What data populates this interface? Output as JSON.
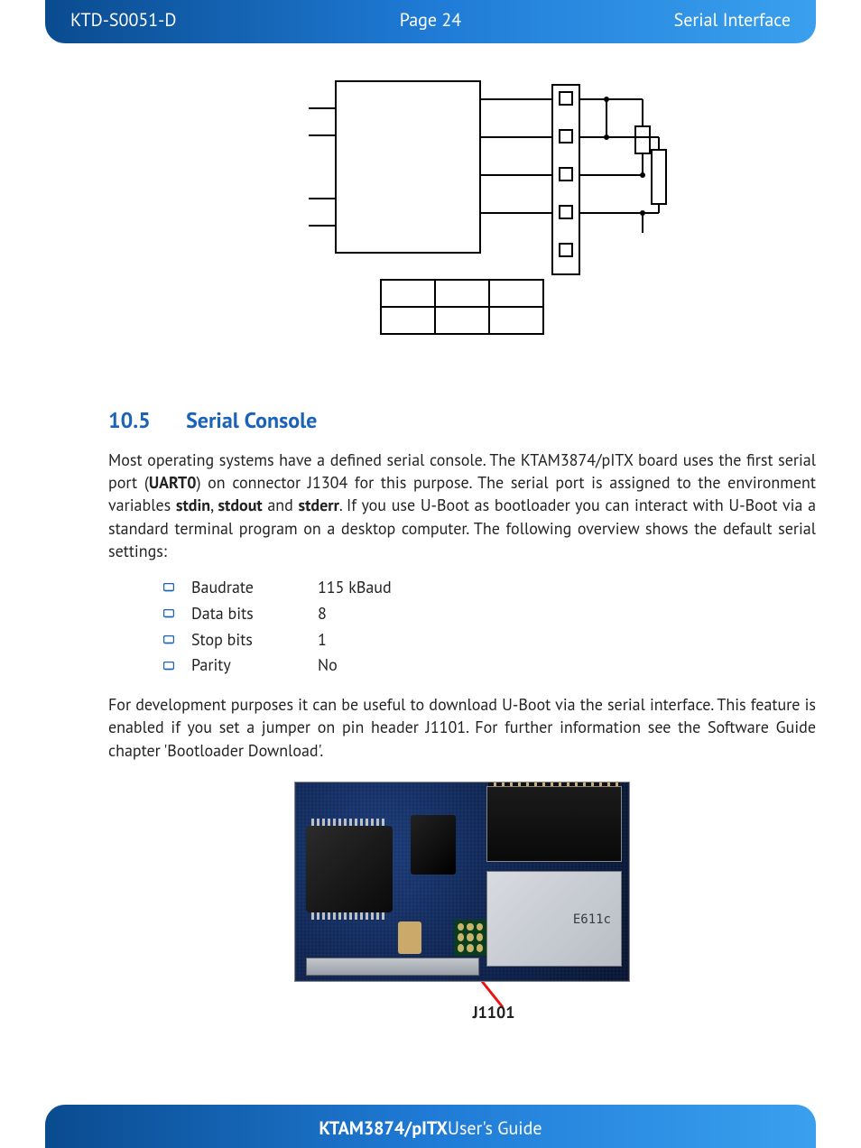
{
  "header": {
    "doc_id": "KTD-S0051-D",
    "page_label": "Page 24",
    "section": "Serial Interface"
  },
  "footer": {
    "product_bold": "KTAM3874/pITX",
    "product_rest": " User's Guide"
  },
  "section_heading": {
    "number": "10.5",
    "title": "Serial Console"
  },
  "para1": {
    "t1": "Most operating systems have a defined serial console. The KTAM3874/pITX board uses the first serial port (",
    "uart": "UART0",
    "t2": ") on connector J1304 for this purpose. The serial port is assigned to the environment variables ",
    "stdin": "stdin",
    "comma1": ", ",
    "stdout": "stdout",
    "and": " and ",
    "stderr": "stderr",
    "t3": ". If you use U-Boot as bootloader you can interact with U-Boot via a standard terminal program on a desktop computer. The following overview shows the default serial settings:"
  },
  "settings": [
    {
      "key": "Baudrate",
      "val": "115 kBaud"
    },
    {
      "key": "Data bits",
      "val": "8"
    },
    {
      "key": "Stop bits",
      "val": "1"
    },
    {
      "key": "Parity",
      "val": "No"
    }
  ],
  "para2": "For development purposes it can be useful to download U-Boot via the serial interface. This feature is enabled if you set a jumper on pin header J1101. For further information see the Software Guide chapter 'Bootloader Download'.",
  "board": {
    "shield_label": "E611c",
    "callout": "J1101"
  }
}
